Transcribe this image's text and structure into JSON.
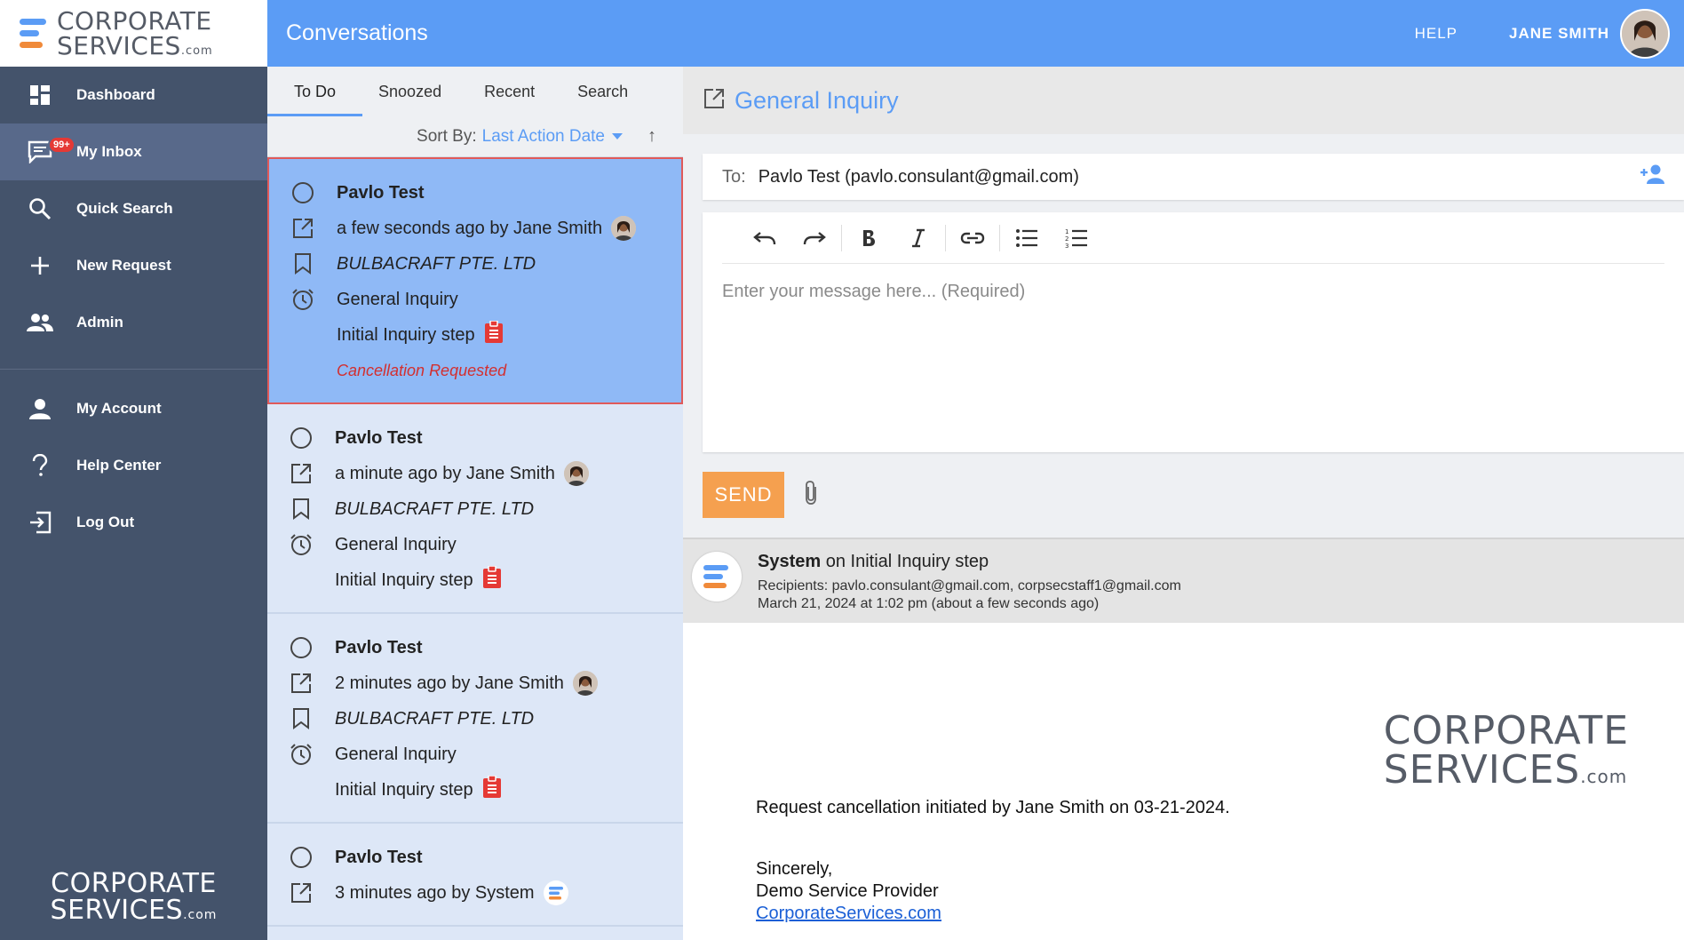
{
  "brand": {
    "line1": "CORPORATE",
    "line2": "SERVICES",
    "suffix": ".com"
  },
  "sidebar": {
    "items": [
      {
        "label": "Dashboard",
        "icon": "dashboard-icon"
      },
      {
        "label": "My Inbox",
        "icon": "chat-icon",
        "badge": "99+"
      },
      {
        "label": "Quick Search",
        "icon": "search-icon"
      },
      {
        "label": "New Request",
        "icon": "plus-icon"
      },
      {
        "label": "Admin",
        "icon": "people-icon"
      }
    ],
    "secondary": [
      {
        "label": "My Account",
        "icon": "person-icon"
      },
      {
        "label": "Help Center",
        "icon": "question-icon"
      },
      {
        "label": "Log Out",
        "icon": "logout-icon"
      }
    ]
  },
  "topbar": {
    "title": "Conversations",
    "help": "HELP",
    "user": "JANE SMITH"
  },
  "list": {
    "tabs": [
      "To Do",
      "Snoozed",
      "Recent",
      "Search"
    ],
    "sort_label": "Sort By:",
    "sort_value": "Last Action Date",
    "sort_arrow": "↑",
    "conversations": [
      {
        "name": "Pavlo Test",
        "time": "a few seconds ago by Jane Smith",
        "company": "BULBACRAFT PTE. LTD",
        "type": "General Inquiry",
        "step": "Initial Inquiry step",
        "status": "Cancellation Requested"
      },
      {
        "name": "Pavlo Test",
        "time": "a minute ago by Jane Smith",
        "company": "BULBACRAFT PTE. LTD",
        "type": "General Inquiry",
        "step": "Initial Inquiry step"
      },
      {
        "name": "Pavlo Test",
        "time": "2 minutes ago by Jane Smith",
        "company": "BULBACRAFT PTE. LTD",
        "type": "General Inquiry",
        "step": "Initial Inquiry step"
      },
      {
        "name": "Pavlo Test",
        "time": "3 minutes ago by System"
      }
    ]
  },
  "detail": {
    "title": "General Inquiry",
    "to_label": "To:",
    "to_value": "Pavlo Test (pavlo.consulant@gmail.com)",
    "placeholder": "Enter your message here... (Required)",
    "send": "SEND",
    "message": {
      "sender": "System",
      "sender_suffix": " on Initial Inquiry step",
      "recipients": "Recipients: pavlo.consulant@gmail.com, corpsecstaff1@gmail.com",
      "date": "March 21, 2024 at 1:02 pm (about a few seconds ago)",
      "body_line": "Request cancellation initiated by Jane Smith on 03-21-2024.",
      "sign1": "Sincerely,",
      "sign2": "Demo Service Provider",
      "link": "CorporateServices.com"
    }
  },
  "colors": {
    "primary": "#5b9cf5",
    "sidebar": "#44536b",
    "accent": "#f5a04f",
    "danger": "#d32f2f"
  }
}
